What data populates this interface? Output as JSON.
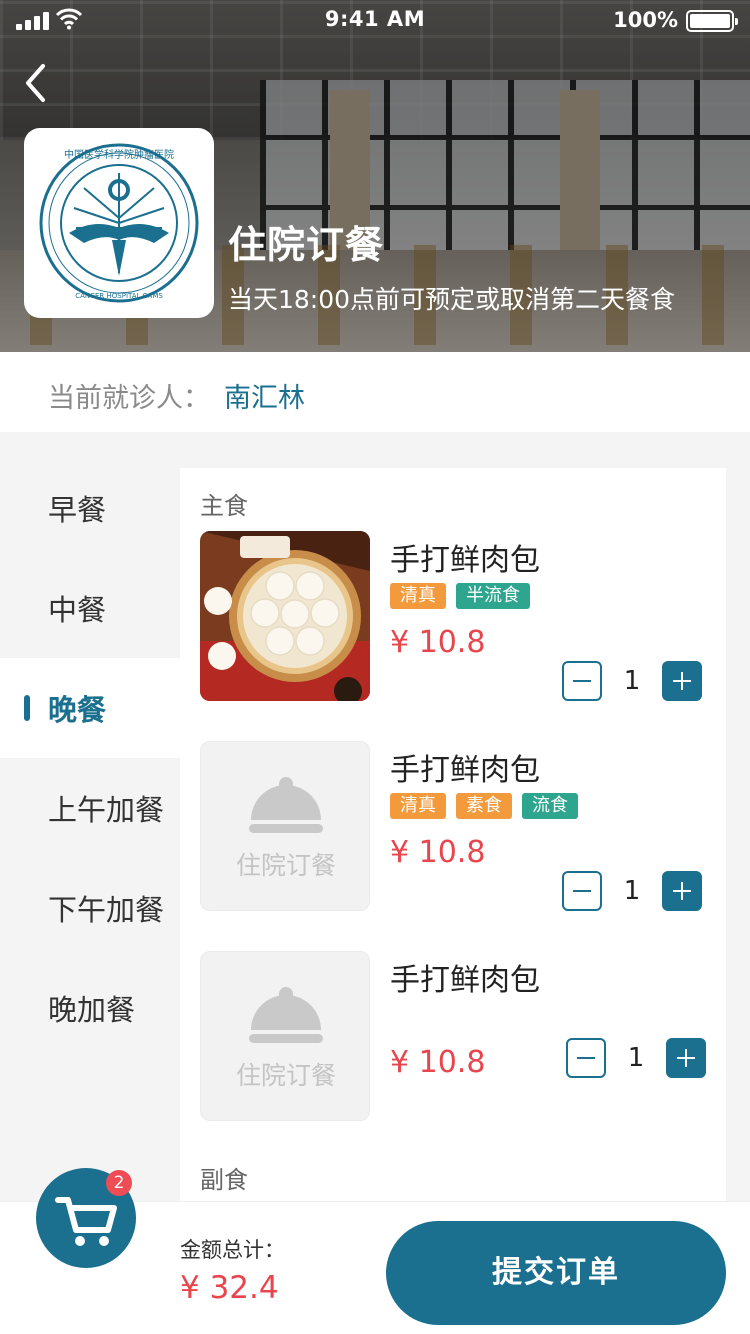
{
  "status_bar": {
    "time": "9:41 AM",
    "battery": "100%"
  },
  "header": {
    "title": "住院订餐",
    "subtitle": "当天18:00点前可预定或取消第二天餐食",
    "logo_text": "中国医学科学院肿瘤医院 CANCER HOSPITAL CHINESE ACADEMY OF MEDICAL SCIENCES"
  },
  "patient": {
    "label": "当前就诊人：",
    "name": "南汇林"
  },
  "sidebar": {
    "items": [
      {
        "label": "早餐"
      },
      {
        "label": "中餐"
      },
      {
        "label": "晚餐"
      },
      {
        "label": "上午加餐"
      },
      {
        "label": "下午加餐"
      },
      {
        "label": "晚加餐"
      }
    ],
    "active_index": 2
  },
  "sections": {
    "main": "主食",
    "side": "副食"
  },
  "placeholder_text": "住院订餐",
  "items": [
    {
      "name": "手打鲜肉包",
      "tags": [
        "清真",
        "半流食"
      ],
      "price": "¥ 10.8",
      "qty": "1"
    },
    {
      "name": "手打鲜肉包",
      "tags": [
        "清真",
        "素食",
        "流食"
      ],
      "price": "¥ 10.8",
      "qty": "1"
    },
    {
      "name": "手打鲜肉包",
      "tags": [],
      "price": "¥ 10.8",
      "qty": "1"
    }
  ],
  "cart": {
    "count": "2"
  },
  "footer": {
    "total_label": "金额总计：",
    "total_value": "¥ 32.4",
    "submit_label": "提交订单"
  },
  "colors": {
    "primary": "#1b6f8f",
    "price": "#e8454c",
    "tag_orange": "#f39a3d",
    "tag_green": "#2ea58f",
    "badge": "#ee4d55"
  },
  "icons": {
    "back": "chevron-left-icon",
    "cart": "cart-icon",
    "placeholder": "cloche-icon",
    "minus": "minus-icon",
    "plus": "plus-icon"
  }
}
